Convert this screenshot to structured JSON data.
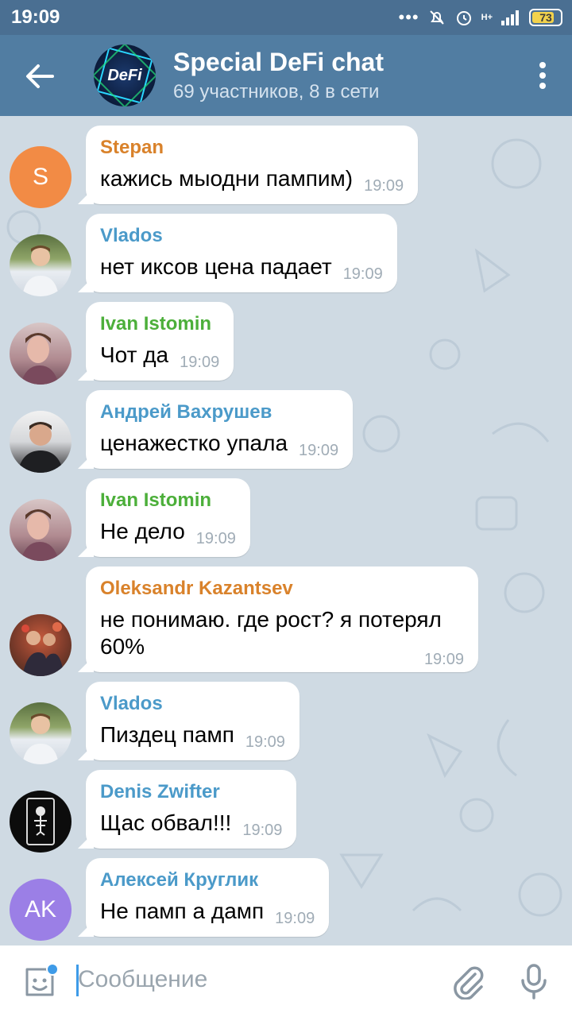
{
  "status_bar": {
    "time": "19:09",
    "battery": "73",
    "network": "H+"
  },
  "header": {
    "title": "Special DeFi chat",
    "subtitle": "69 участников, 8 в сети",
    "avatar_text": "DeFi"
  },
  "messages": [
    {
      "sender": "Stepan",
      "sender_color": "#d9822b",
      "text": "кажись мыодни пампим)",
      "time": "19:09",
      "avatar": {
        "type": "initials",
        "initials": "S",
        "color": "#f28b45"
      }
    },
    {
      "sender": "Vlados",
      "sender_color": "#4b9ac9",
      "text": "нет иксов цена падает",
      "time": "19:09",
      "avatar": {
        "type": "photo",
        "color": "#6b7a4e"
      }
    },
    {
      "sender": "Ivan Istomin",
      "sender_color": "#4caf3a",
      "text": "Чот да",
      "time": "19:09",
      "avatar": {
        "type": "photo",
        "color": "#a87d86"
      }
    },
    {
      "sender": "Андрей Вахрушев",
      "sender_color": "#4b9ac9",
      "text": "ценажестко упала",
      "time": "19:09",
      "avatar": {
        "type": "photo",
        "color": "#3c3c3f"
      }
    },
    {
      "sender": "Ivan Istomin",
      "sender_color": "#4caf3a",
      "text": "Не дело",
      "time": "19:09",
      "avatar": {
        "type": "photo",
        "color": "#a87d86"
      }
    },
    {
      "sender": "Oleksandr Kazantsev",
      "sender_color": "#d9822b",
      "text": "не понимаю. где рост? я потерял 60%",
      "time": "19:09",
      "avatar": {
        "type": "photo",
        "color": "#8a4a36"
      }
    },
    {
      "sender": "Vlados",
      "sender_color": "#4b9ac9",
      "text": "Пиздец памп",
      "time": "19:09",
      "avatar": {
        "type": "photo",
        "color": "#6b7a4e"
      }
    },
    {
      "sender": "Denis Zwifter",
      "sender_color": "#4b9ac9",
      "text": "Щас обвал!!!",
      "time": "19:09",
      "avatar": {
        "type": "photo",
        "color": "#111111"
      }
    },
    {
      "sender": "Алексей Круглик",
      "sender_color": "#4b9ac9",
      "text": "Не памп а дамп",
      "time": "19:09",
      "avatar": {
        "type": "initials",
        "initials": "AK",
        "color": "#9b7fe6"
      }
    }
  ],
  "composer": {
    "placeholder": "Сообщение"
  },
  "icons": {
    "back": "arrow-left-icon",
    "menu": "kebab-menu-icon",
    "emoji": "sticker-icon",
    "attach": "paperclip-icon",
    "mic": "microphone-icon"
  }
}
